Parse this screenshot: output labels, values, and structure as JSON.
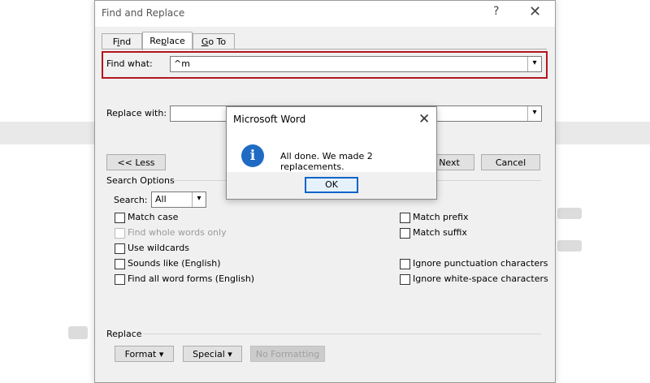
{
  "dialog": {
    "title": "Find and Replace",
    "help_glyph": "?",
    "close_glyph": "✕"
  },
  "tabs": [
    {
      "pre": "F",
      "key": "i",
      "post": "nd"
    },
    {
      "pre": "Re",
      "key": "p",
      "post": "lace"
    },
    {
      "pre": "",
      "key": "G",
      "post": "o To"
    }
  ],
  "find": {
    "label": "Find what:",
    "value": "^m"
  },
  "replace": {
    "label": "Replace with:",
    "value": ""
  },
  "buttons": {
    "less": "<< Less",
    "find_next": "Find Next",
    "cancel": "Cancel",
    "format": "Format ▾",
    "special": "Special ▾",
    "no_formatting": "No Formatting"
  },
  "search_options": {
    "title": "Search Options",
    "search_label": "Search:",
    "search_value": "All"
  },
  "checkboxes_left": [
    {
      "label": "Match case",
      "enabled": true
    },
    {
      "label": "Find whole words only",
      "enabled": false
    },
    {
      "label": "Use wildcards",
      "enabled": true
    },
    {
      "label": "Sounds like (English)",
      "enabled": true
    },
    {
      "label": "Find all word forms (English)",
      "enabled": true
    }
  ],
  "checkboxes_right": [
    {
      "label": "Match prefix",
      "enabled": true
    },
    {
      "label": "Match suffix",
      "enabled": true
    },
    {
      "label": "Ignore punctuation characters",
      "enabled": true
    },
    {
      "label": "Ignore white-space characters",
      "enabled": true
    }
  ],
  "replace_section": {
    "title": "Replace"
  },
  "message_box": {
    "title": "Microsoft Word",
    "text": "All done. We made 2 replacements.",
    "icon": "info-icon",
    "ok": "OK"
  },
  "colors": {
    "highlight": "#b4151c",
    "info_icon": "#1f6bc4",
    "ok_focus": "#0a64c8"
  }
}
